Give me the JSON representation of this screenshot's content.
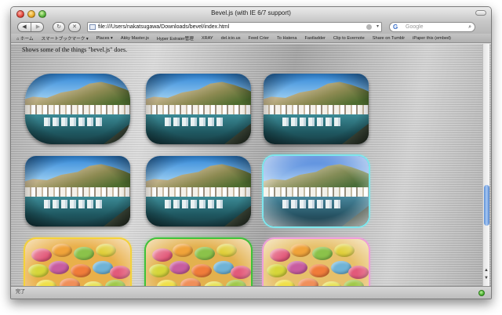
{
  "window": {
    "title": "Bevel.js (with IE 6/7 support)"
  },
  "toolbar": {
    "back_icon": "back-arrow-icon",
    "forward_icon": "forward-arrow-icon",
    "url": "file:///Users/nakatsugawa/Downloads/bevel/index.html",
    "search_placeholder": "Google"
  },
  "bookmarks": [
    {
      "label": "⌂ ホーム"
    },
    {
      "label": "スマートブックマーク ▾"
    },
    {
      "label": "Places ▾"
    },
    {
      "label": "Akky Master.js"
    },
    {
      "label": "Hyper Estraier管理"
    },
    {
      "label": "XRAY"
    },
    {
      "label": "del.icio.us"
    },
    {
      "label": "Feed Crier"
    },
    {
      "label": "To Hatena"
    },
    {
      "label": "Fastladder"
    },
    {
      "label": "Clip to Evernote"
    },
    {
      "label": "Share on Tumblr"
    },
    {
      "label": "iPaper this (embed)"
    }
  ],
  "page": {
    "caption": "Shows some of the things \"bevel.js\" does."
  },
  "thumbnails": {
    "row1": [
      "harbor",
      "harbor",
      "harbor"
    ],
    "row2": [
      "harbor",
      "harbor",
      "harbor-glow"
    ],
    "row3": [
      "candies-yellow-glow",
      "candies-green-glow",
      "candies-pink-glow"
    ],
    "glow_colors": {
      "cyan": "#7fe6ec",
      "yellow": "#f5d23a",
      "green": "#3fc23a",
      "pink": "#ee9edb"
    }
  },
  "statusbar": {
    "text": "完了"
  }
}
